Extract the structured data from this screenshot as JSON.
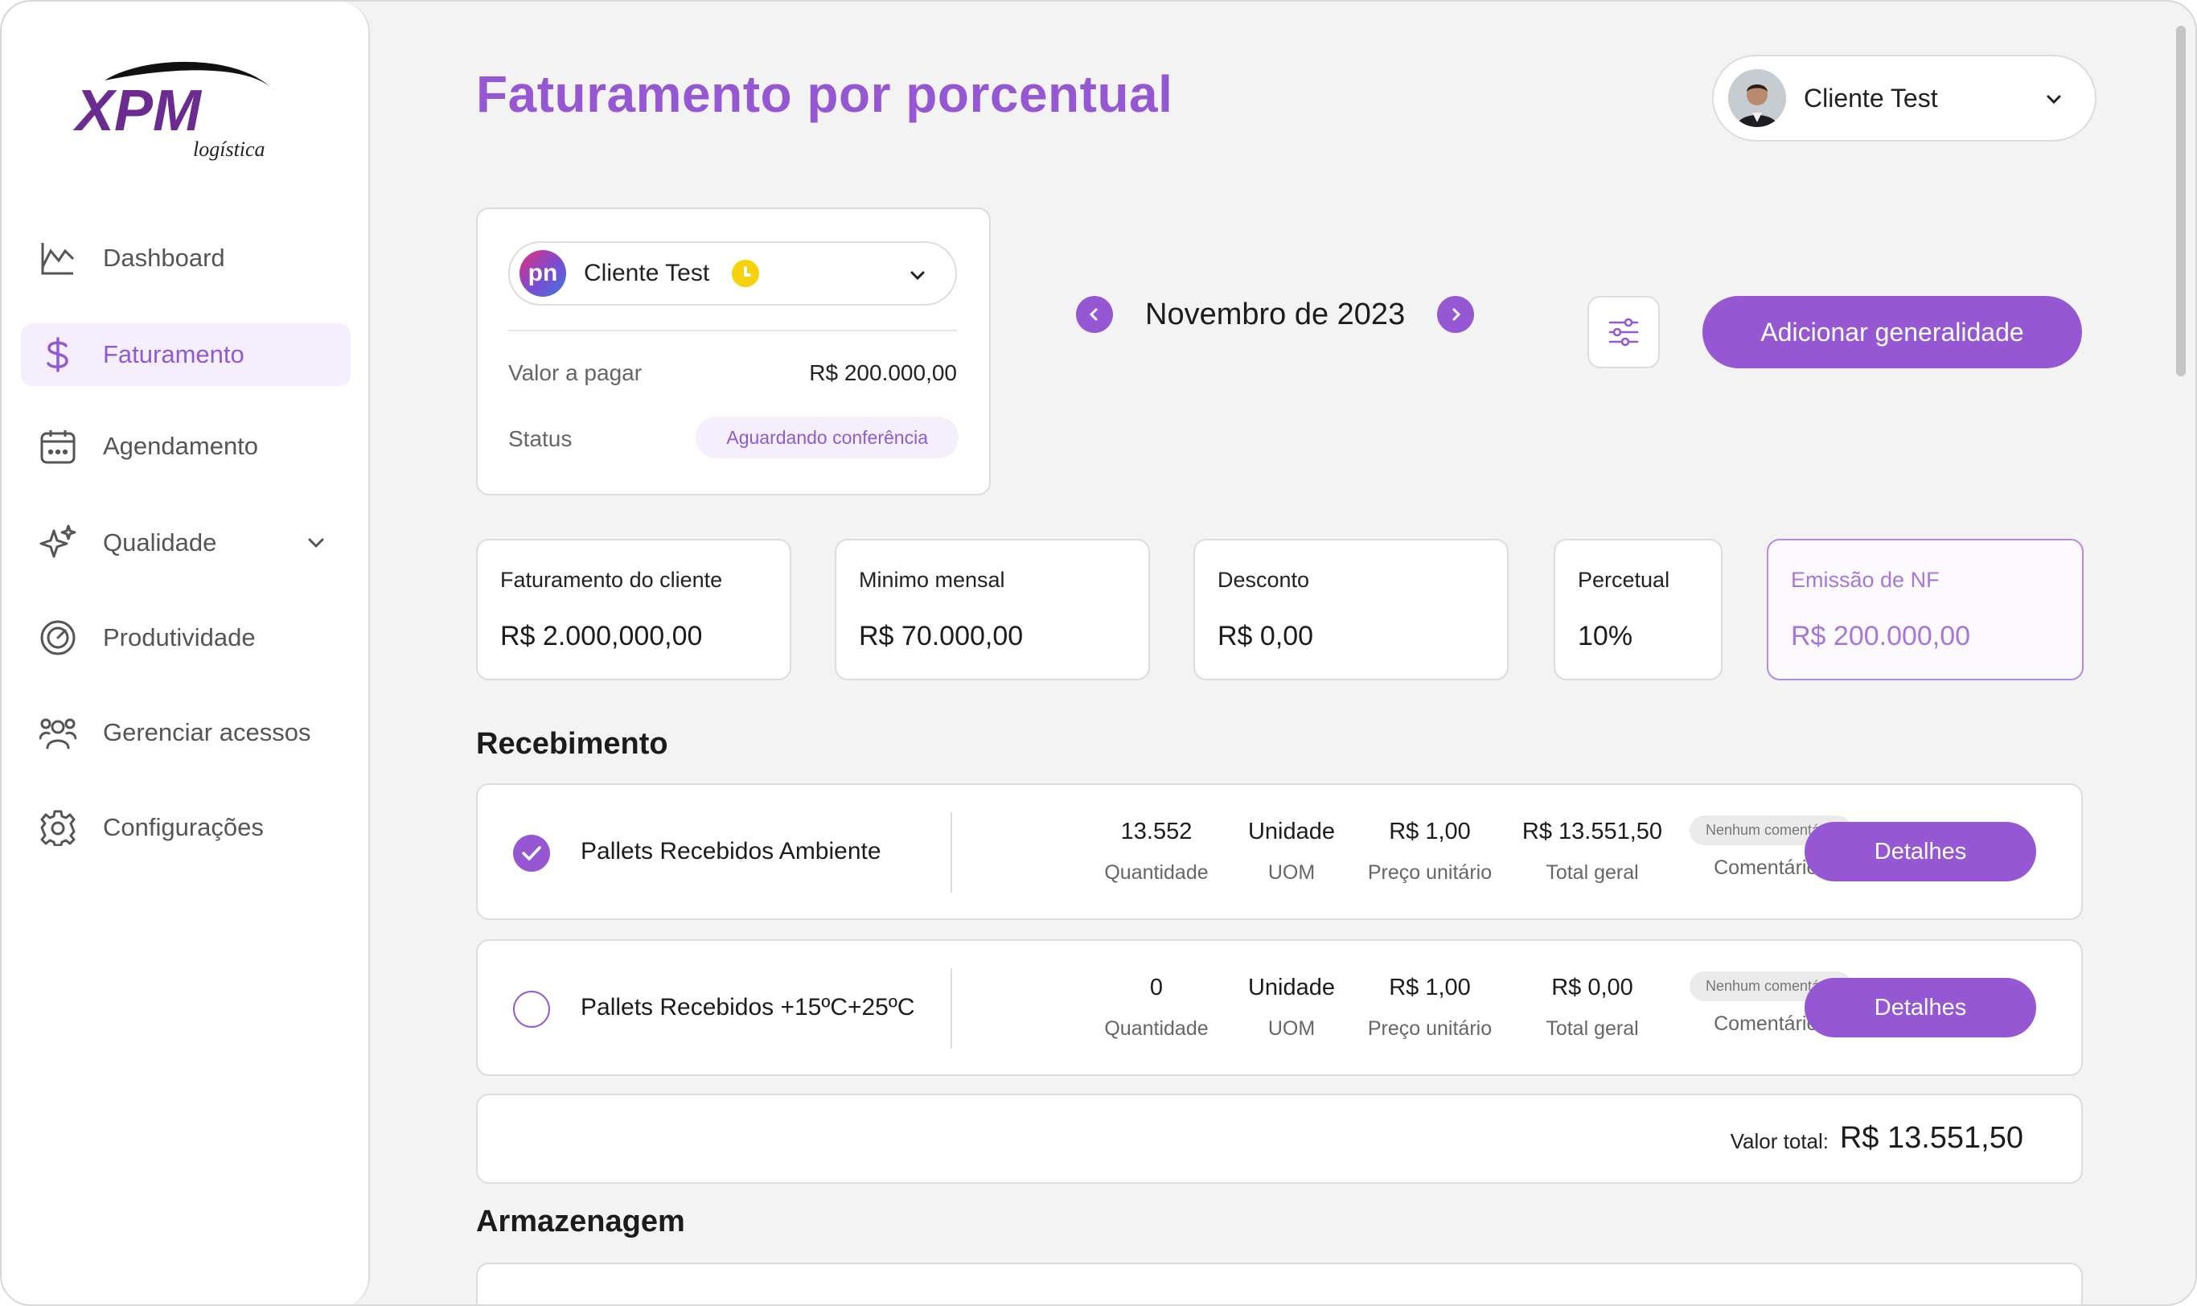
{
  "brand": {
    "logo_text": "XPM",
    "logo_sub": "logística",
    "accent": "#9558d2"
  },
  "sidebar": {
    "items": [
      {
        "label": "Dashboard",
        "icon": "chart-icon"
      },
      {
        "label": "Faturamento",
        "icon": "dollar-icon",
        "active": true
      },
      {
        "label": "Agendamento",
        "icon": "calendar-icon"
      },
      {
        "label": "Qualidade",
        "icon": "sparkle-icon",
        "expandable": true
      },
      {
        "label": "Produtividade",
        "icon": "gauge-icon"
      },
      {
        "label": "Gerenciar acessos",
        "icon": "users-icon"
      },
      {
        "label": "Configurações",
        "icon": "gear-icon"
      }
    ]
  },
  "header": {
    "title": "Faturamento por porcentual",
    "user_name": "Cliente Test"
  },
  "client_card": {
    "client_name": "Cliente Test",
    "client_logo": "pn",
    "amount_label": "Valor a pagar",
    "amount_value": "R$ 200.000,00",
    "status_label": "Status",
    "status_value": "Aguardando conferência"
  },
  "period": {
    "label": "Novembro de 2023"
  },
  "actions": {
    "add_label": "Adicionar generalidade"
  },
  "metrics": [
    {
      "label": "Faturamento do cliente",
      "value": "R$ 2.000,000,00"
    },
    {
      "label": "Minimo mensal",
      "value": "R$ 70.000,00"
    },
    {
      "label": "Desconto",
      "value": "R$ 0,00"
    },
    {
      "label": "Percetual",
      "value": "10%"
    },
    {
      "label": "Emissão de NF",
      "value": "R$ 200.000,00",
      "highlight": true
    }
  ],
  "sections": {
    "recebimento_title": "Recebimento",
    "armazenagem_title": "Armazenagem"
  },
  "column_labels": {
    "quantity": "Quantidade",
    "uom": "UOM",
    "unit_price": "Preço unitário",
    "total": "Total geral",
    "comments": "Comentários",
    "details": "Detalhes"
  },
  "rows": [
    {
      "name": "Pallets Recebidos Ambiente",
      "checked": true,
      "quantity": "13.552",
      "uom": "Unidade",
      "unit_price": "R$ 1,00",
      "total": "R$ 13.551,50",
      "comment": "Nenhum comentário"
    },
    {
      "name": "Pallets Recebidos +15ºC+25ºC",
      "checked": false,
      "quantity": "0",
      "uom": "Unidade",
      "unit_price": "R$ 1,00",
      "total": "R$ 0,00",
      "comment": "Nenhum comentário"
    }
  ],
  "totals": {
    "label": "Valor total:",
    "value": "R$ 13.551,50"
  }
}
